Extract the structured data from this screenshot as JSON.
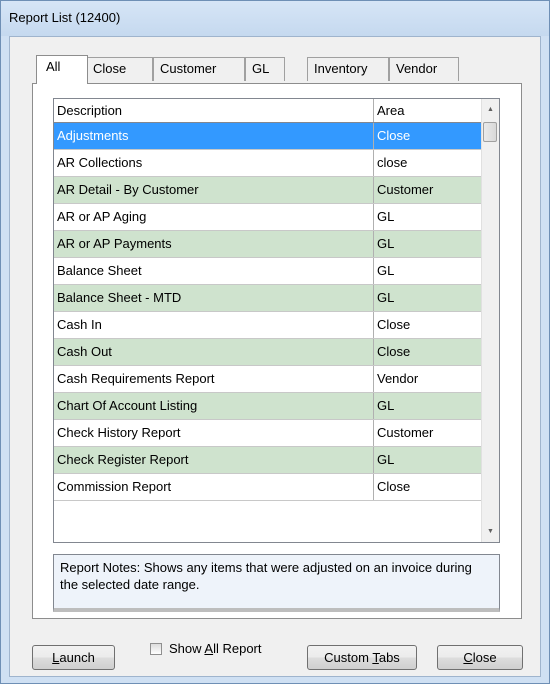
{
  "window": {
    "title": "Report List (12400)"
  },
  "tabs": [
    "All",
    "Close",
    "Customer",
    "GL",
    "Inventory",
    "Vendor"
  ],
  "grid": {
    "columns": [
      "Description",
      "Area"
    ],
    "rows": [
      {
        "description": "Adjustments",
        "area": "Close"
      },
      {
        "description": "AR Collections",
        "area": "close"
      },
      {
        "description": "AR Detail - By Customer",
        "area": "Customer"
      },
      {
        "description": "AR or AP Aging",
        "area": "GL"
      },
      {
        "description": "AR or AP Payments",
        "area": "GL"
      },
      {
        "description": "Balance Sheet",
        "area": "GL"
      },
      {
        "description": "Balance Sheet - MTD",
        "area": "GL"
      },
      {
        "description": "Cash In",
        "area": "Close"
      },
      {
        "description": "Cash Out",
        "area": "Close"
      },
      {
        "description": "Cash Requirements Report",
        "area": "Vendor"
      },
      {
        "description": "Chart Of Account Listing",
        "area": "GL"
      },
      {
        "description": "Check History Report",
        "area": "Customer"
      },
      {
        "description": "Check Register Report",
        "area": "GL"
      },
      {
        "description": "Commission Report",
        "area": "Close"
      }
    ],
    "selected_index": 0
  },
  "notes": "Report Notes:  Shows any items that were adjusted on an invoice during the selected date range.",
  "controls": {
    "launch": "Launch",
    "show_all": "Show All Report",
    "custom_tabs": "Custom Tabs",
    "close": "Close"
  },
  "icons": {
    "scroll_up": "scroll-up-arrow-icon",
    "scroll_down": "scroll-down-arrow-icon"
  },
  "colors": {
    "selected": "#3399ff",
    "alt_row": "#cfe3ce",
    "titlebar": "#c5d9ef"
  }
}
